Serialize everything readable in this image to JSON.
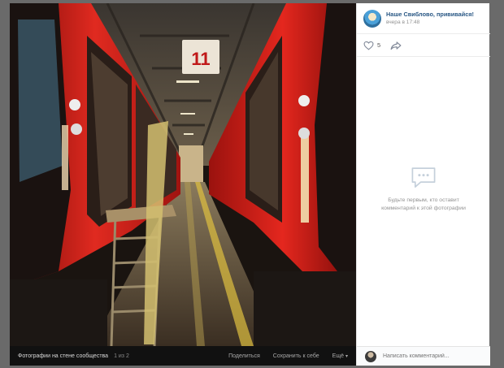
{
  "post": {
    "author_name": "Наше Свиблово, прививайся!",
    "time": "вчера в 17:48",
    "likes": "5"
  },
  "comments": {
    "empty_text": "Будьте первым, кто оставит комментарий к этой фотографии",
    "input_placeholder": "Написать комментарий..."
  },
  "photo_bar": {
    "album": "Фотографии на стене сообщества",
    "counter": "1 из 2",
    "share": "Поделиться",
    "save": "Сохранить к себе",
    "more": "Ещё"
  },
  "photo": {
    "sign_text": "11"
  },
  "icons": {
    "like": "heart-outline-icon",
    "share": "share-arrow-icon",
    "empty": "comment-bubble-icon",
    "more": "chevron-down-icon"
  },
  "colors": {
    "link": "#2a5885",
    "train_red": "#d8231c",
    "muted": "#939393"
  }
}
